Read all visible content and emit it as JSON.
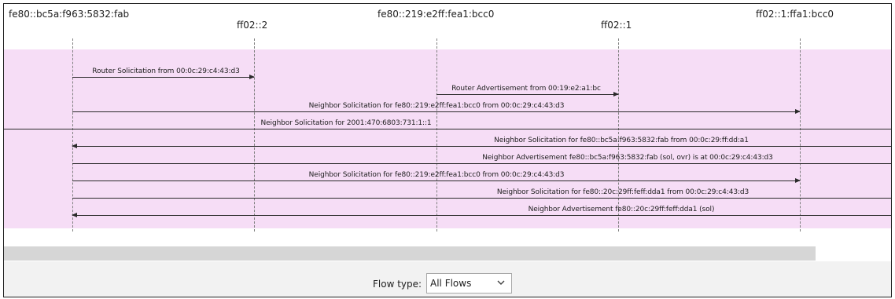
{
  "hosts": [
    {
      "label": "fe80::bc5a:f963:5832:fab"
    },
    {
      "label": "ff02::2"
    },
    {
      "label": "fe80::219:e2ff:fea1:bcc0"
    },
    {
      "label": "ff02::1"
    },
    {
      "label": "ff02::1:ffa1:bcc0"
    }
  ],
  "flows": [
    {
      "label": "Router Solicitation from 00:0c:29:c4:43:d3",
      "from": 0,
      "to": 1
    },
    {
      "label": "Router Advertisement from 00:19:e2:a1:bc",
      "from": 2,
      "to": 3
    },
    {
      "label": "Neighbor Solicitation for fe80::219:e2ff:fea1:bcc0 from 00:0c:29:c4:43:d3",
      "from": 0,
      "to": 4
    },
    {
      "label": "Neighbor Solicitation for 2001:470:6803:731:1::1",
      "from": "left-edge",
      "to": "right-edge"
    },
    {
      "label": "Neighbor Solicitation for fe80::bc5a:f963:5832:fab from 00:0c:29:ff:dd:a1",
      "from": "right-edge",
      "to": 0
    },
    {
      "label": "Neighbor Advertisement fe80::bc5a:f963:5832:fab (sol, ovr) is at 00:0c:29:c4:43:d3",
      "from": 0,
      "to": "right-edge"
    },
    {
      "label": "Neighbor Solicitation for fe80::219:e2ff:fea1:bcc0 from 00:0c:29:c4:43:d3",
      "from": 0,
      "to": 4
    },
    {
      "label": "Neighbor Solicitation for fe80::20c:29ff:feff:dda1 from 00:0c:29:c4:43:d3",
      "from": 0,
      "to": "right-edge"
    },
    {
      "label": "Neighbor Advertisement fe80::20c:29ff:feff:dda1 (sol)",
      "from": "right-edge",
      "to": 0
    }
  ],
  "footer": {
    "flow_type_label": "Flow type:",
    "flow_type_value": "All Flows"
  },
  "colors": {
    "band": "#f6ddf6",
    "footer": "#f2f2f2",
    "scrollbar": "#d6d6d6"
  },
  "icons": {
    "dropdown": "chevron-down-icon"
  }
}
